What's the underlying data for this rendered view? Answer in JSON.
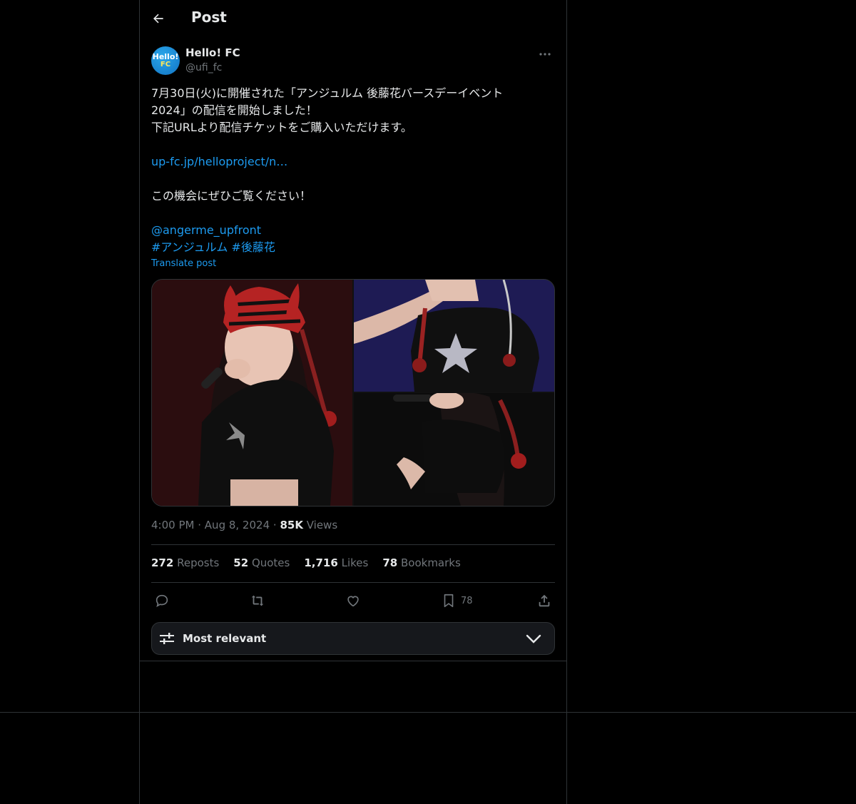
{
  "header": {
    "title": "Post"
  },
  "author": {
    "name": "Hello! FC",
    "handle": "@ufi_fc",
    "avatar_text_1": "Hello!",
    "avatar_text_2": "FC"
  },
  "post": {
    "lines": [
      "7月30日(火)に開催された「アンジュルム 後藤花バースデーイベント",
      "2024」の配信を開始しました！",
      "下記URLより配信チケットをご購入いただけます。",
      "",
      "",
      "",
      "この機会にぜひご覧ください！",
      "",
      "",
      ""
    ],
    "link": "up-fc.jp/helloproject/n…",
    "mention": "@angerme_upfront",
    "hashtag_1": "#アンジュルム",
    "hashtag_2": "#後藤花",
    "translate_label": "Translate post"
  },
  "meta": {
    "time": "4:00 PM",
    "date": "Aug 8, 2024",
    "views_count": "85K",
    "views_label": "Views",
    "separator": "·"
  },
  "stats": {
    "reposts_count": "272",
    "reposts_label": "Reposts",
    "quotes_count": "52",
    "quotes_label": "Quotes",
    "likes_count": "1,716",
    "likes_label": "Likes",
    "bookmarks_count": "78",
    "bookmarks_label": "Bookmarks"
  },
  "actions": {
    "bookmark_count": "78"
  },
  "sort": {
    "label": "Most relevant"
  },
  "icons": [
    "back-arrow-icon",
    "more-icon",
    "reply-icon",
    "repost-icon",
    "like-icon",
    "bookmark-icon",
    "share-icon",
    "sliders-icon",
    "chevron-down-icon"
  ],
  "colors": {
    "background": "#000000",
    "text": "#e7e9ea",
    "muted": "#71767b",
    "accent": "#1d9bf0",
    "border": "#2f3336"
  }
}
